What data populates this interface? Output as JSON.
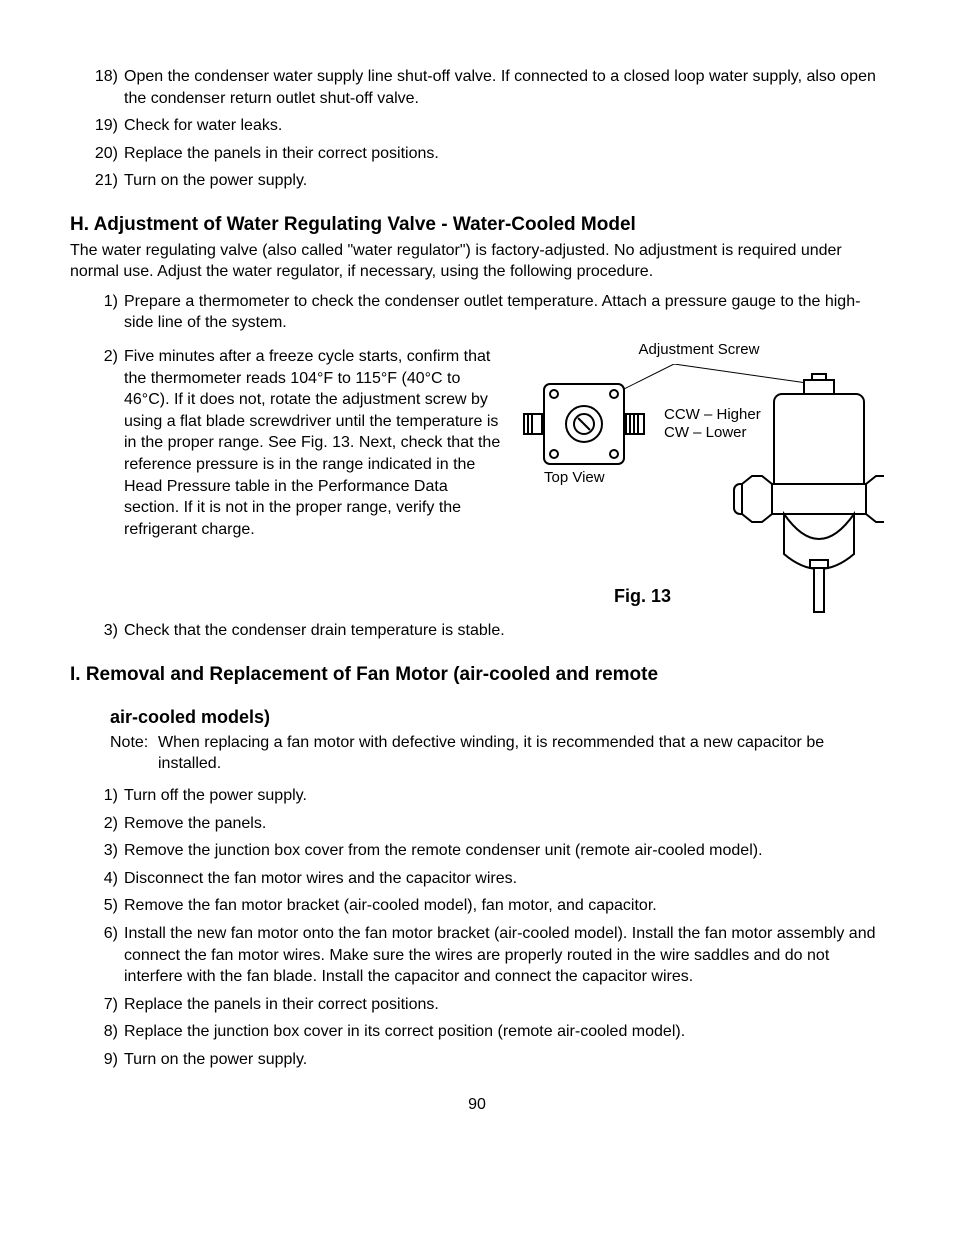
{
  "top_steps": [
    {
      "n": "18)",
      "t": "Open the condenser water supply line shut-off valve. If connected to a closed loop water supply, also open the condenser return outlet shut-off valve."
    },
    {
      "n": "19)",
      "t": "Check for water leaks."
    },
    {
      "n": "20)",
      "t": "Replace the panels in their correct positions."
    },
    {
      "n": "21)",
      "t": "Turn on the power supply."
    }
  ],
  "section_h": {
    "heading": "H. Adjustment of Water Regulating Valve - Water-Cooled Model",
    "intro": "The water regulating valve (also called \"water regulator\") is factory-adjusted. No adjustment is required under normal use. Adjust the water regulator, if necessary, using the following procedure.",
    "steps": [
      {
        "n": "1)",
        "t": "Prepare a thermometer to check the condenser outlet temperature. Attach a pressure gauge to the high-side line of the system."
      },
      {
        "n": "2)",
        "t": "Five minutes after a freeze cycle starts, confirm that the thermometer reads 104°F to 115°F (40°C to 46°C). If it does not, rotate the adjustment screw by using a flat blade screwdriver until the temperature is in the proper range. See Fig. 13. Next, check that the reference pressure is in the range indicated in the Head Pressure table in the Performance Data section. If it is not in the proper range, verify the refrigerant charge."
      },
      {
        "n": "3)",
        "t": "Check that the condenser drain temperature is stable."
      }
    ],
    "figure": {
      "top_label": "Adjustment Screw",
      "ccw": "CCW – Higher",
      "cw": "CW – Lower",
      "topview": "Top View",
      "caption": "Fig. 13"
    }
  },
  "section_i": {
    "heading": "I. Removal and Replacement of Fan Motor (air-cooled and remote",
    "sub_heading": "air-cooled models)",
    "note_label": "Note:",
    "note_text": "When replacing a fan motor with defective winding, it is recommended that a new capacitor be installed.",
    "steps": [
      {
        "n": "1)",
        "t": "Turn off the power supply."
      },
      {
        "n": "2)",
        "t": "Remove the panels."
      },
      {
        "n": "3)",
        "t": "Remove the junction box cover from the remote condenser unit (remote air-cooled model)."
      },
      {
        "n": "4)",
        "t": "Disconnect the fan motor wires and the capacitor wires."
      },
      {
        "n": "5)",
        "t": "Remove the fan motor bracket (air-cooled model), fan motor, and capacitor."
      },
      {
        "n": "6)",
        "t": "Install the new fan motor onto the fan motor bracket (air-cooled model). Install the fan motor assembly and connect the fan motor wires. Make sure the wires are properly routed in the wire saddles and do not interfere with the fan blade. Install the capacitor and connect the capacitor wires."
      },
      {
        "n": "7)",
        "t": "Replace the panels in their correct positions."
      },
      {
        "n": "8)",
        "t": "Replace the junction box cover in its correct position (remote air-cooled model)."
      },
      {
        "n": "9)",
        "t": "Turn on the power supply."
      }
    ]
  },
  "page_number": "90"
}
